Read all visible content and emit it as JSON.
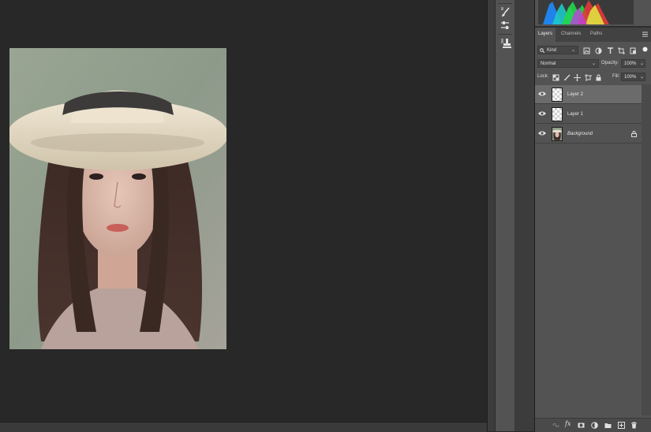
{
  "layers_panel": {
    "tabs": [
      "Layers",
      "Channels",
      "Paths"
    ],
    "active_tab": "Layers",
    "filter": {
      "kind_label": "Kind"
    },
    "blend_mode": "Normal",
    "opacity_label": "Opacity:",
    "opacity_value": "100%",
    "lock_label": "Lock:",
    "fill_label": "Fill:",
    "fill_value": "100%",
    "layers": [
      {
        "name": "Layer 2",
        "selected": true,
        "visible": true,
        "locked": false
      },
      {
        "name": "Layer 1",
        "selected": false,
        "visible": true,
        "locked": false
      },
      {
        "name": "Background",
        "selected": false,
        "visible": true,
        "locked": true
      }
    ],
    "bottom_icons": [
      "link-icon",
      "fx-icon",
      "mask-icon",
      "adjustment-icon",
      "folder-icon",
      "new-layer-icon",
      "trash-icon"
    ],
    "fx_label": "fx"
  },
  "dock_icons": [
    "brush-icon",
    "adjustments-icon",
    "clone-stamp-icon"
  ],
  "colors": {
    "workspace": "#282828",
    "panel": "#535353",
    "selected_layer": "#6b6b6b"
  }
}
